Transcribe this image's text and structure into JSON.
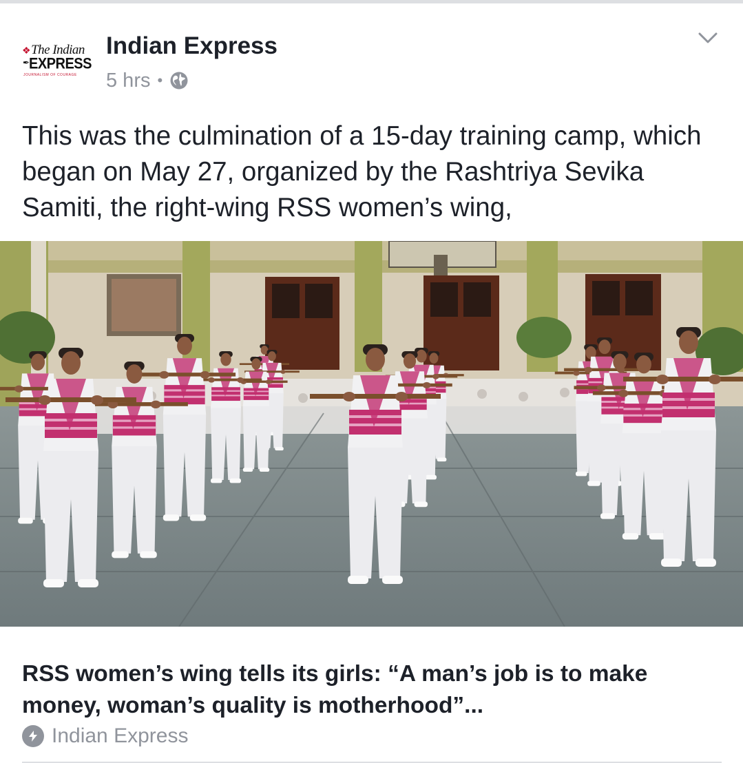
{
  "post": {
    "page_name": "Indian Express",
    "timestamp": "5 hrs",
    "separator": "•",
    "privacy_icon": "globe-icon",
    "menu_icon": "chevron-down-icon",
    "text": "This was the culmination of a 15-day training camp, which began on May 27, organized by the Rashtriya Sevika Samiti, the right-wing RSS women’s wing,"
  },
  "avatar": {
    "logo_line1": "The Indian",
    "logo_line2": "EXPRESS",
    "logo_line3": "JOURNALISM OF COURAGE"
  },
  "link": {
    "title": "RSS women’s wing tells its girls: “A man’s job is to make money, woman’s quality is motherhood”...",
    "source": "Indian Express",
    "source_icon": "instant-article-bolt-icon"
  },
  "colors": {
    "text_primary": "#1d2129",
    "text_secondary": "#90949c",
    "divider": "#dddfe2",
    "brand_red": "#c4122f",
    "uniform_pink": "#c2306f"
  }
}
